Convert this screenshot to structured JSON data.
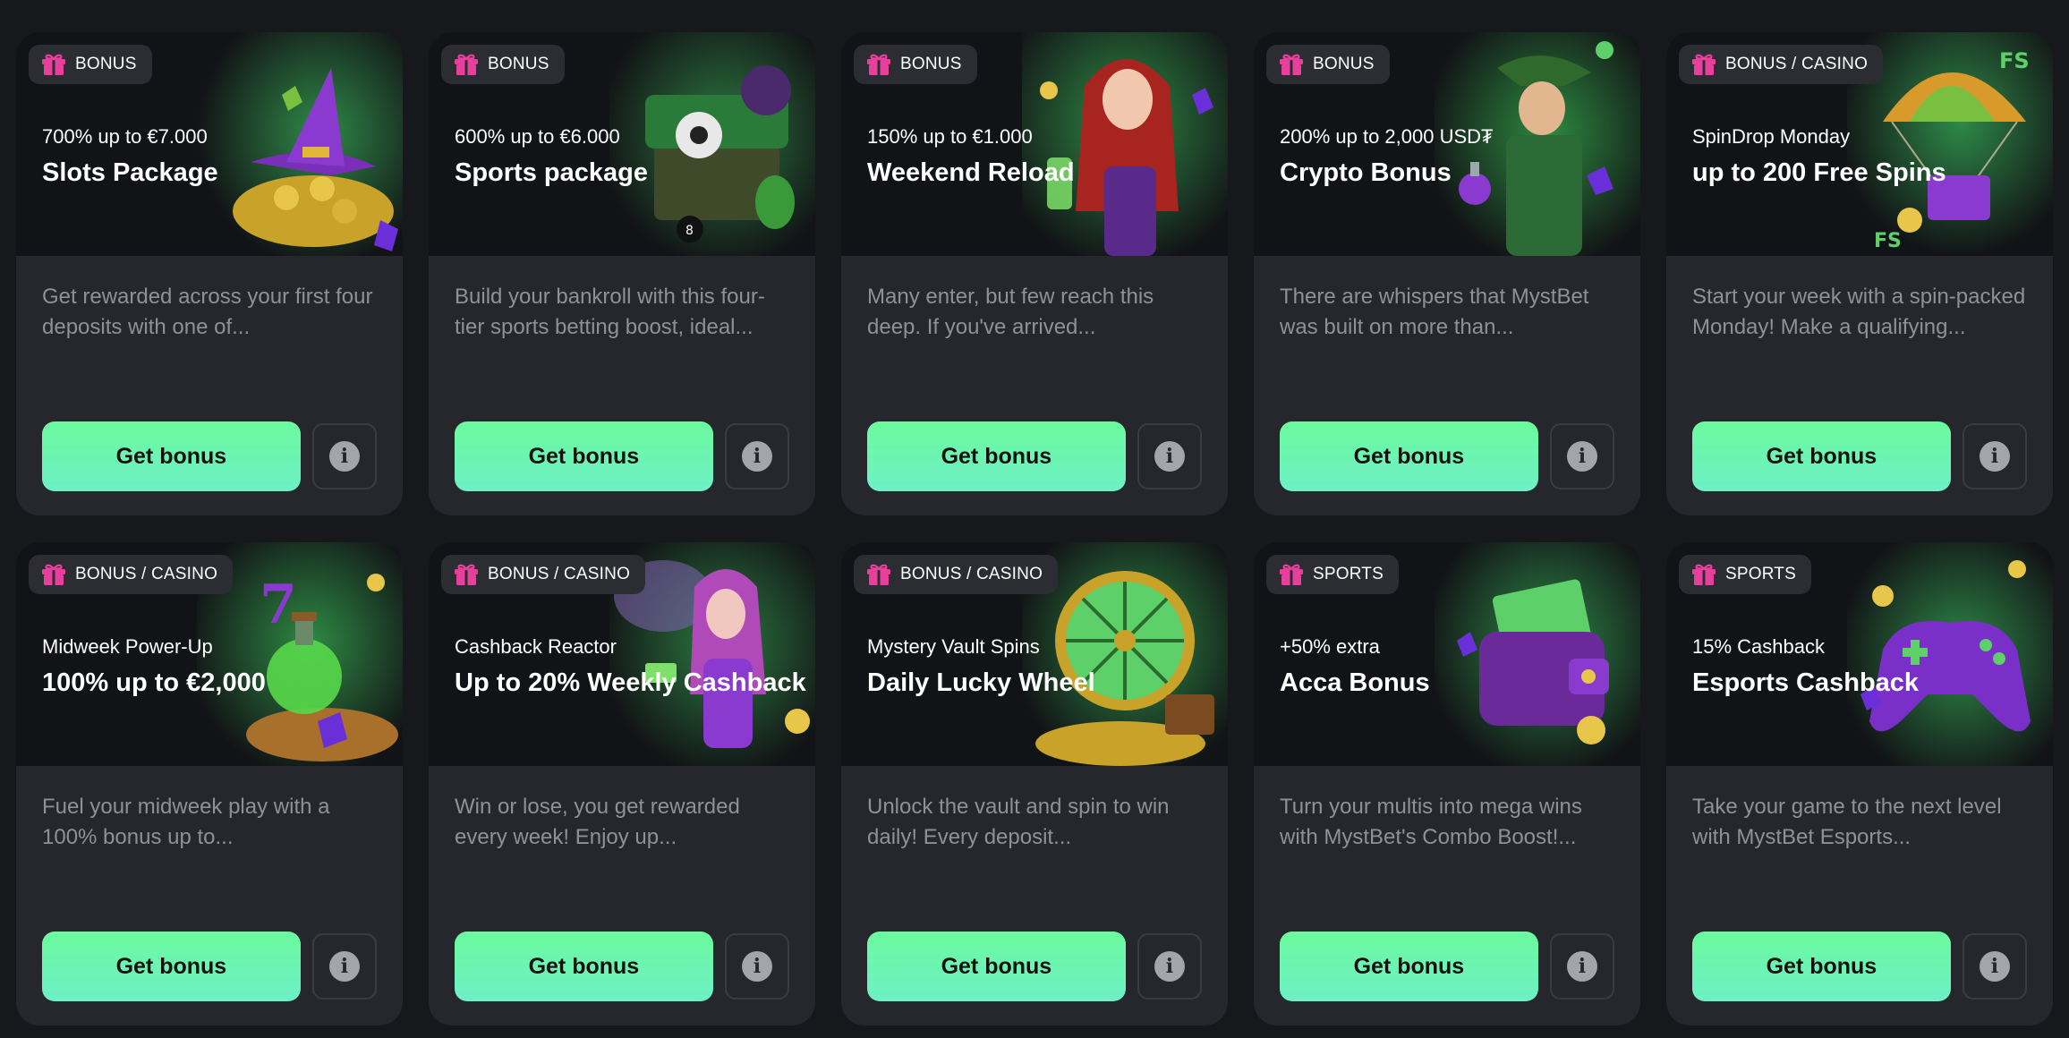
{
  "colors": {
    "page_bg": "#17181c",
    "card_bg": "#25272d",
    "banner_bg": "#121316",
    "accent_green": "#6bfa9d",
    "gift_pink": "#e83f9d",
    "desc_text": "#8f9198"
  },
  "icons": {
    "badge": "gift-icon",
    "info": "info-icon"
  },
  "cards": [
    {
      "badge": "BONUS",
      "subtitle": "700% up to €7.000",
      "title": "Slots Package",
      "description": "Get rewarded across your first four deposits with one of...",
      "button": "Get bonus",
      "art": "wizard-hat-gold-coins"
    },
    {
      "badge": "BONUS",
      "subtitle": "600% up to €6.000",
      "title": "Sports package",
      "description": "Build your bankroll with this four-tier sports betting boost, ideal...",
      "button": "Get bonus",
      "art": "treasure-chest-sports-balls"
    },
    {
      "badge": "BONUS",
      "subtitle": "150% up to €1.000",
      "title": "Weekend Reload",
      "description": "Many enter, but few reach this deep. If you've arrived...",
      "button": "Get bonus",
      "art": "red-haired-woman-green-drink"
    },
    {
      "badge": "BONUS",
      "subtitle": "200% up to 2,000 USD₮",
      "title": "Crypto Bonus",
      "description": "There are whispers that MystBet was built on more than...",
      "button": "Get bonus",
      "art": "elf-with-potion"
    },
    {
      "badge": "BONUS / CASINO",
      "subtitle": "SpinDrop Monday",
      "title": "up to 200 Free Spins",
      "description": "Start your week with a spin-packed Monday! Make a qualifying...",
      "button": "Get bonus",
      "art": "parachute-chest-fs"
    },
    {
      "badge": "BONUS / CASINO",
      "subtitle": "Midweek Power-Up",
      "title": "100% up to €2,000",
      "description": "Fuel your midweek play with a 100% bonus up to...",
      "button": "Get bonus",
      "art": "potion-flask-seven"
    },
    {
      "badge": "BONUS / CASINO",
      "subtitle": "Cashback Reactor",
      "title": "Up to 20% Weekly Cashback",
      "description": "Win or lose, you get rewarded every week! Enjoy up...",
      "button": "Get bonus",
      "art": "fairy-with-coins"
    },
    {
      "badge": "BONUS / CASINO",
      "subtitle": "Mystery Vault Spins",
      "title": "Daily Lucky Wheel",
      "description": "Unlock the vault and spin to win daily! Every deposit...",
      "button": "Get bonus",
      "art": "lucky-wheel-treasure"
    },
    {
      "badge": "SPORTS",
      "subtitle": "+50% extra",
      "title": "Acca Bonus",
      "description": "Turn your multis into mega wins with MystBet's Combo Boost!...",
      "button": "Get bonus",
      "art": "purple-wallet-cash"
    },
    {
      "badge": "SPORTS",
      "subtitle": "15% Cashback",
      "title": "Esports Cashback",
      "description": "Take your game to the next level with MystBet Esports...",
      "button": "Get bonus",
      "art": "purple-gamepad"
    }
  ]
}
